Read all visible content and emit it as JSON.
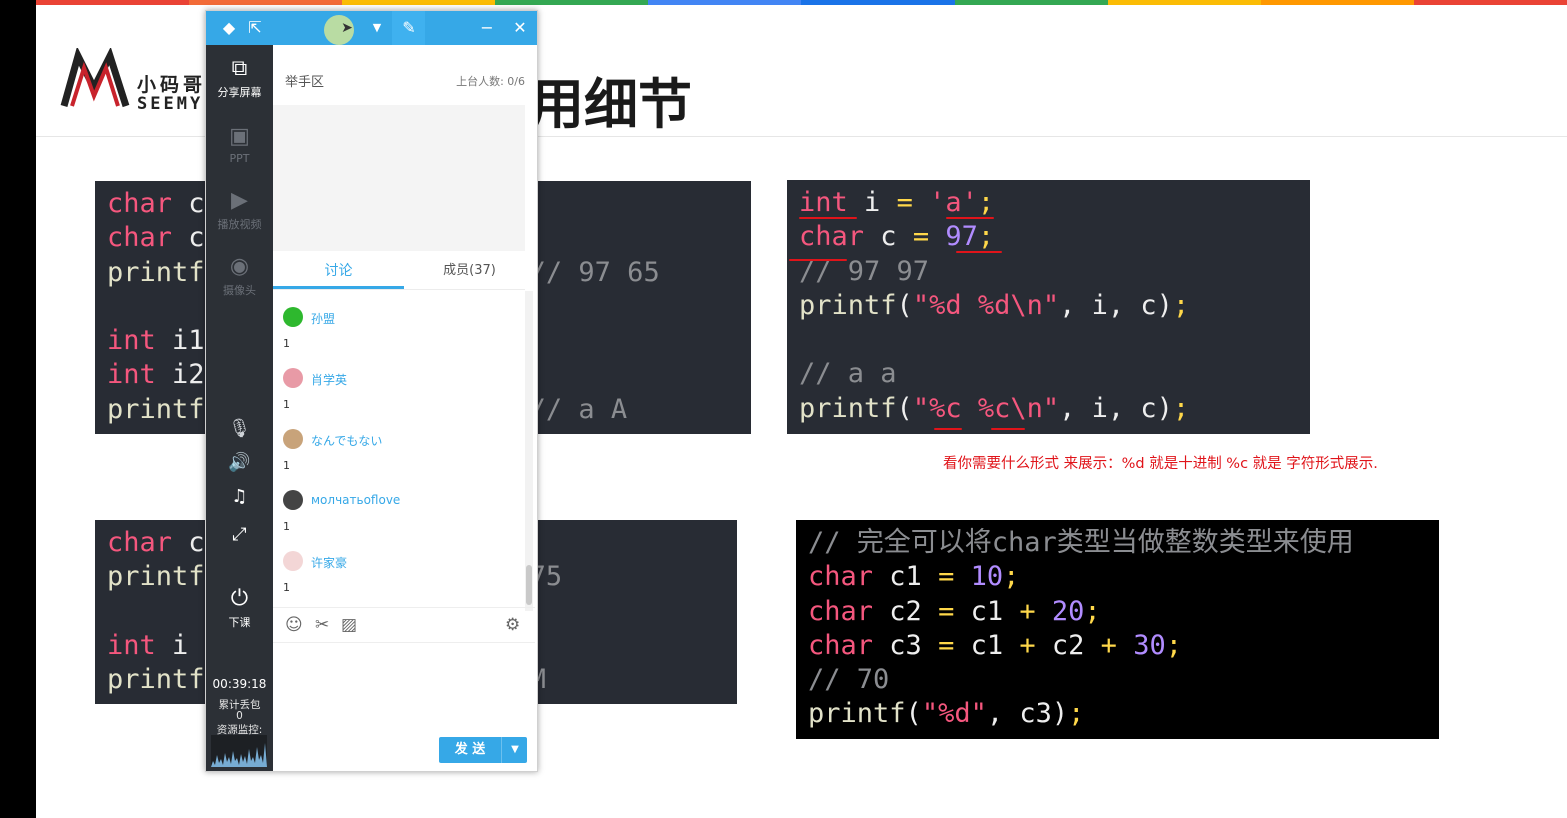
{
  "slide": {
    "logo": {
      "cn": "小码哥",
      "en": "SEEMY"
    },
    "title": "用细节",
    "rainbow_colors": [
      "#ea4335",
      "#f26b38",
      "#fbbc05",
      "#34a853",
      "#4285f4",
      "#1a73e8",
      "#34a853",
      "#fbbc05",
      "#ff9800",
      "#ea4335"
    ],
    "note": "看你需要什么形式 来展示：%d 就是十进制    %c 就是 字符形式展示."
  },
  "code_blocks": {
    "top_left": [
      [
        {
          "t": "char",
          "c": "kw"
        },
        {
          "t": " c",
          "c": "plain"
        }
      ],
      [
        {
          "t": "char",
          "c": "kw"
        },
        {
          "t": " c",
          "c": "plain"
        }
      ],
      [
        {
          "t": "printf",
          "c": "fn"
        },
        {
          "t": "                 ); // 97 65",
          "c": "cm"
        }
      ],
      [
        {
          "t": "",
          "c": "plain"
        }
      ],
      [
        {
          "t": "int",
          "c": "kw"
        },
        {
          "t": " i1",
          "c": "plain"
        }
      ],
      [
        {
          "t": "int",
          "c": "kw"
        },
        {
          "t": " i2",
          "c": "plain"
        }
      ],
      [
        {
          "t": "printf",
          "c": "fn"
        },
        {
          "t": "                 ); // a A",
          "c": "cm"
        }
      ]
    ],
    "top_right": [
      [
        {
          "t": "int",
          "c": "kw"
        },
        {
          "t": " i ",
          "c": "plain"
        },
        {
          "t": "=",
          "c": "op"
        },
        {
          "t": " ",
          "c": "plain"
        },
        {
          "t": "'a'",
          "c": "str"
        },
        {
          "t": ";",
          "c": "op"
        }
      ],
      [
        {
          "t": "char",
          "c": "kw"
        },
        {
          "t": " c ",
          "c": "plain"
        },
        {
          "t": "=",
          "c": "op"
        },
        {
          "t": " ",
          "c": "plain"
        },
        {
          "t": "97",
          "c": "num"
        },
        {
          "t": ";",
          "c": "op"
        }
      ],
      [
        {
          "t": "// 97 97",
          "c": "cm"
        }
      ],
      [
        {
          "t": "printf",
          "c": "fn"
        },
        {
          "t": "(",
          "c": "plain"
        },
        {
          "t": "\"%d %d\\n\"",
          "c": "str"
        },
        {
          "t": ", i, c)",
          "c": "plain"
        },
        {
          "t": ";",
          "c": "op"
        }
      ],
      [
        {
          "t": "",
          "c": "plain"
        }
      ],
      [
        {
          "t": "// a a",
          "c": "cm"
        }
      ],
      [
        {
          "t": "printf",
          "c": "fn"
        },
        {
          "t": "(",
          "c": "plain"
        },
        {
          "t": "\"%c %c\\n\"",
          "c": "str"
        },
        {
          "t": ", i, c)",
          "c": "plain"
        },
        {
          "t": ";",
          "c": "op"
        }
      ]
    ],
    "bottom_left": [
      [
        {
          "t": "char",
          "c": "kw"
        },
        {
          "t": " c",
          "c": "plain"
        }
      ],
      [
        {
          "t": "printf",
          "c": "fn"
        },
        {
          "t": "                 // 75",
          "c": "cm"
        }
      ],
      [
        {
          "t": "",
          "c": "plain"
        }
      ],
      [
        {
          "t": "int",
          "c": "kw"
        },
        {
          "t": " i",
          "c": "plain"
        }
      ],
      [
        {
          "t": "printf",
          "c": "fn"
        },
        {
          "t": "                 // M",
          "c": "cm"
        }
      ]
    ],
    "bottom_right": [
      [
        {
          "t": "// 完全可以将char类型当做整数类型来使用",
          "c": "cm"
        }
      ],
      [
        {
          "t": "char",
          "c": "kw"
        },
        {
          "t": " c1 ",
          "c": "plain"
        },
        {
          "t": "=",
          "c": "op"
        },
        {
          "t": " ",
          "c": "plain"
        },
        {
          "t": "10",
          "c": "num"
        },
        {
          "t": ";",
          "c": "op"
        }
      ],
      [
        {
          "t": "char",
          "c": "kw"
        },
        {
          "t": " c2 ",
          "c": "plain"
        },
        {
          "t": "=",
          "c": "op"
        },
        {
          "t": " c1 ",
          "c": "plain"
        },
        {
          "t": "+",
          "c": "op"
        },
        {
          "t": " ",
          "c": "plain"
        },
        {
          "t": "20",
          "c": "num"
        },
        {
          "t": ";",
          "c": "op"
        }
      ],
      [
        {
          "t": "char",
          "c": "kw"
        },
        {
          "t": " c3 ",
          "c": "plain"
        },
        {
          "t": "=",
          "c": "op"
        },
        {
          "t": " c1 ",
          "c": "plain"
        },
        {
          "t": "+",
          "c": "op"
        },
        {
          "t": " c2 ",
          "c": "plain"
        },
        {
          "t": "+",
          "c": "op"
        },
        {
          "t": " ",
          "c": "plain"
        },
        {
          "t": "30",
          "c": "num"
        },
        {
          "t": ";",
          "c": "op"
        }
      ],
      [
        {
          "t": "// 70",
          "c": "cm"
        }
      ],
      [
        {
          "t": "printf",
          "c": "fn"
        },
        {
          "t": "(",
          "c": "plain"
        },
        {
          "t": "\"%d\"",
          "c": "str"
        },
        {
          "t": ", c3)",
          "c": "plain"
        },
        {
          "t": ";",
          "c": "op"
        }
      ]
    ]
  },
  "panel": {
    "titlebar": {
      "icons": [
        "diamond-icon",
        "share-icon",
        "cursor-icon",
        "dropdown-icon",
        "pin-icon",
        "minimize-icon",
        "close-icon"
      ],
      "minimize": "−",
      "close": "✕"
    },
    "sidebar": {
      "share_screen": "分享屏幕",
      "ppt": "PPT",
      "play_video": "播放视频",
      "camera": "摄像头",
      "end_class": "下课",
      "timer": "00:39:18",
      "packet_loss_label": "累计丢包",
      "packet_loss_value": "0",
      "resource_monitor": "资源监控:"
    },
    "hand_raise": "举手区",
    "seat_count": "上台人数: 0/6",
    "tabs": {
      "discussion": "讨论",
      "members": "成员(37)"
    },
    "messages": [
      {
        "name": "孙盟",
        "text": "1",
        "avatar_color": "#2eb82e"
      },
      {
        "name": "肖学英",
        "text": "1",
        "avatar_color": "#e89aa6"
      },
      {
        "name": "なんでもない",
        "text": "1",
        "avatar_color": "#c8a37a"
      },
      {
        "name": "молчатьoflove",
        "text": "1",
        "avatar_color": "#444444"
      },
      {
        "name": "许家豪",
        "text": "1",
        "avatar_color": "#f3d6d6"
      }
    ],
    "send": {
      "label": "发 送",
      "dropdown": "▼"
    }
  }
}
